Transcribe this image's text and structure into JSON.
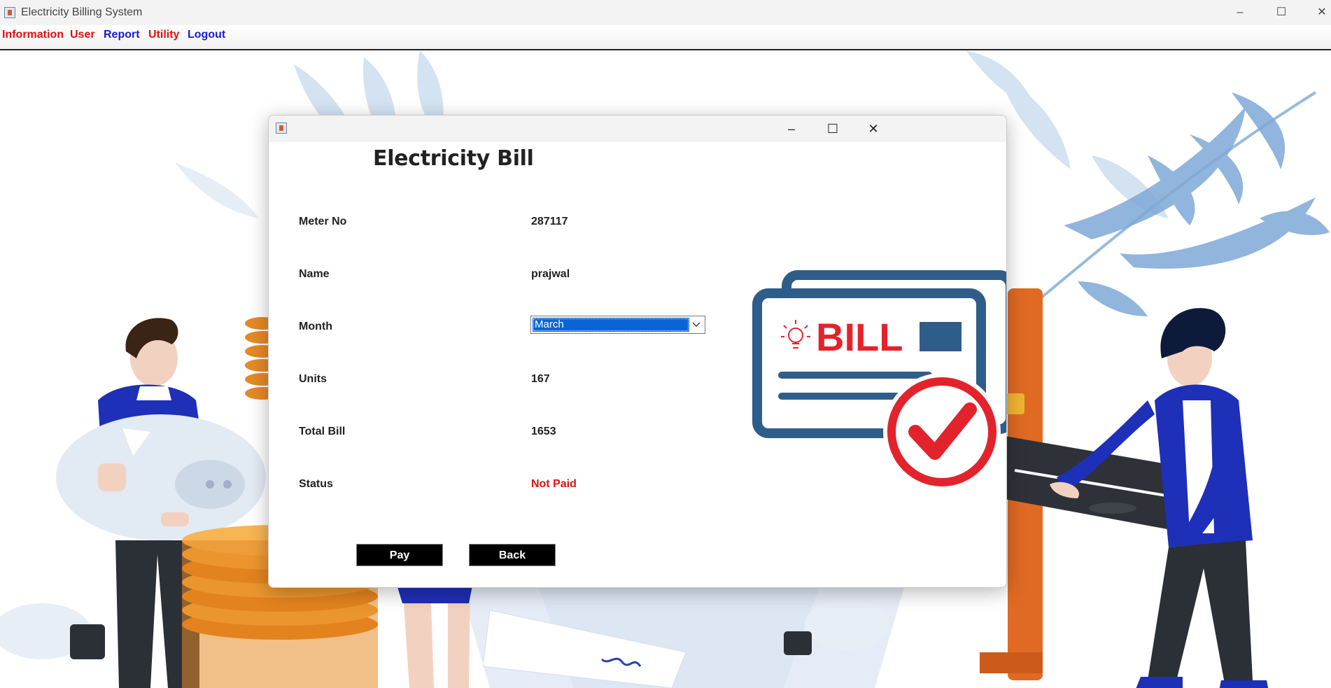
{
  "window": {
    "title": "Electricity Billing System",
    "controls": {
      "minimize": "–",
      "maximize": "☐",
      "close": "✕"
    }
  },
  "menu": {
    "items": [
      {
        "label": "Information",
        "color": "#e01010"
      },
      {
        "label": "User",
        "color": "#e01010"
      },
      {
        "label": "Report",
        "color": "#1a1ad0"
      },
      {
        "label": "Utility",
        "color": "#e01010"
      },
      {
        "label": "Logout",
        "color": "#1a1ad0"
      }
    ]
  },
  "dialog": {
    "controls": {
      "minimize": "–",
      "maximize": "☐",
      "close": "✕"
    },
    "heading": "Electricity Bill",
    "fields": {
      "meter_no": {
        "label": "Meter No",
        "value": "287117"
      },
      "name": {
        "label": "Name",
        "value": "prajwal"
      },
      "month": {
        "label": "Month",
        "value": "March"
      },
      "units": {
        "label": "Units",
        "value": "167"
      },
      "total_bill": {
        "label": "Total Bill",
        "value": "1653"
      },
      "status": {
        "label": "Status",
        "value": "Not Paid",
        "color": "#e01010"
      }
    },
    "buttons": {
      "pay": "Pay",
      "back": "Back"
    },
    "bill_image": {
      "text": "BILL",
      "icon": "bill-paid-check-icon"
    }
  },
  "colors": {
    "bill_blue": "#2f5d8a",
    "bill_red": "#e3232c",
    "selection_blue": "#0a64d8"
  }
}
